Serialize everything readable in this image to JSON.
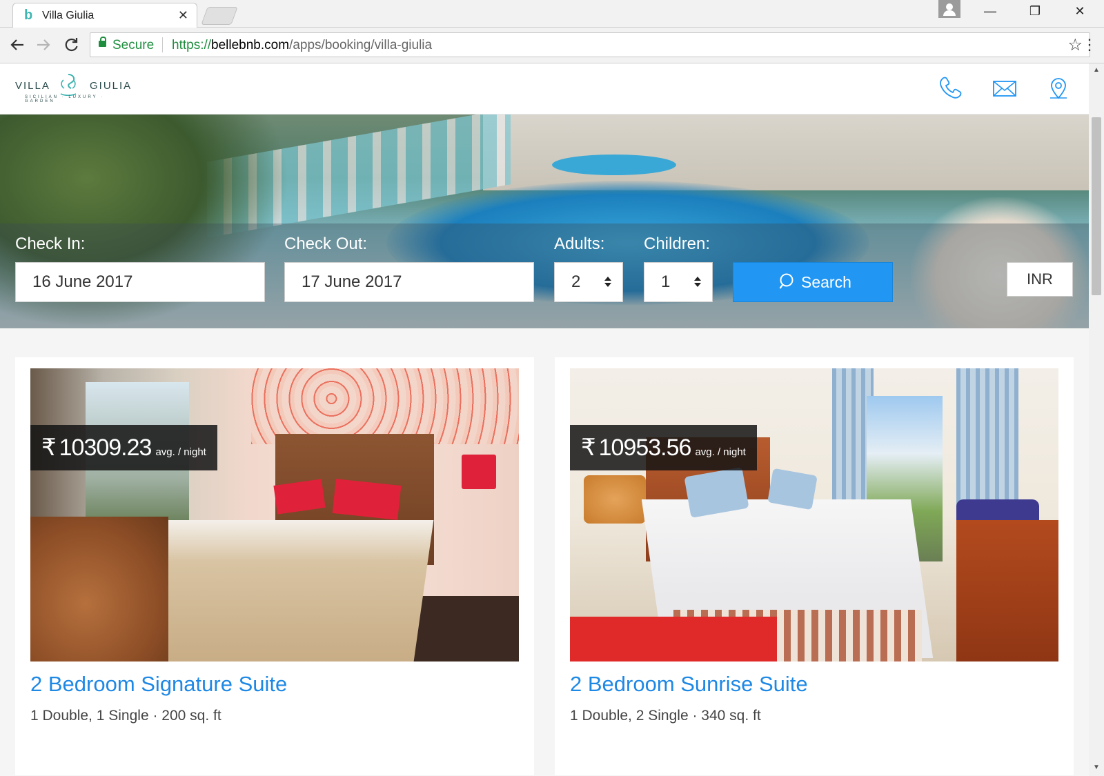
{
  "browser": {
    "tab_title": "Villa Giulia",
    "tab_favicon": "b",
    "tab_close": "✕",
    "security_label": "Secure",
    "url_scheme": "https://",
    "url_host": "bellebnb.com",
    "url_path": "/apps/booking/villa-giulia",
    "window_controls": {
      "minimize": "—",
      "restore": "❐",
      "close": "✕"
    }
  },
  "site": {
    "logo": {
      "left": "VILLA",
      "right": "GIULIA",
      "tagline": "SICILIAN · LUXURY · GARDEN"
    },
    "header_icons": [
      "phone-icon",
      "envelope-icon",
      "map-pin-icon"
    ],
    "accent_color": "#2196f3"
  },
  "booking": {
    "check_in_label": "Check In:",
    "check_in_value": "16 June 2017",
    "check_out_label": "Check Out:",
    "check_out_value": "17 June 2017",
    "adults_label": "Adults:",
    "adults_value": "2",
    "children_label": "Children:",
    "children_value": "1",
    "search_label": "Search",
    "currency": "INR"
  },
  "rooms": [
    {
      "currency_symbol": "₹",
      "price": "10309.23",
      "price_unit": "avg. / night",
      "title": "2 Bedroom Signature Suite",
      "meta": "1 Double, 1 Single · 200 sq. ft"
    },
    {
      "currency_symbol": "₹",
      "price": "10953.56",
      "price_unit": "avg. / night",
      "title": "2 Bedroom Sunrise Suite",
      "meta": "1 Double, 2 Single · 340 sq. ft"
    }
  ]
}
